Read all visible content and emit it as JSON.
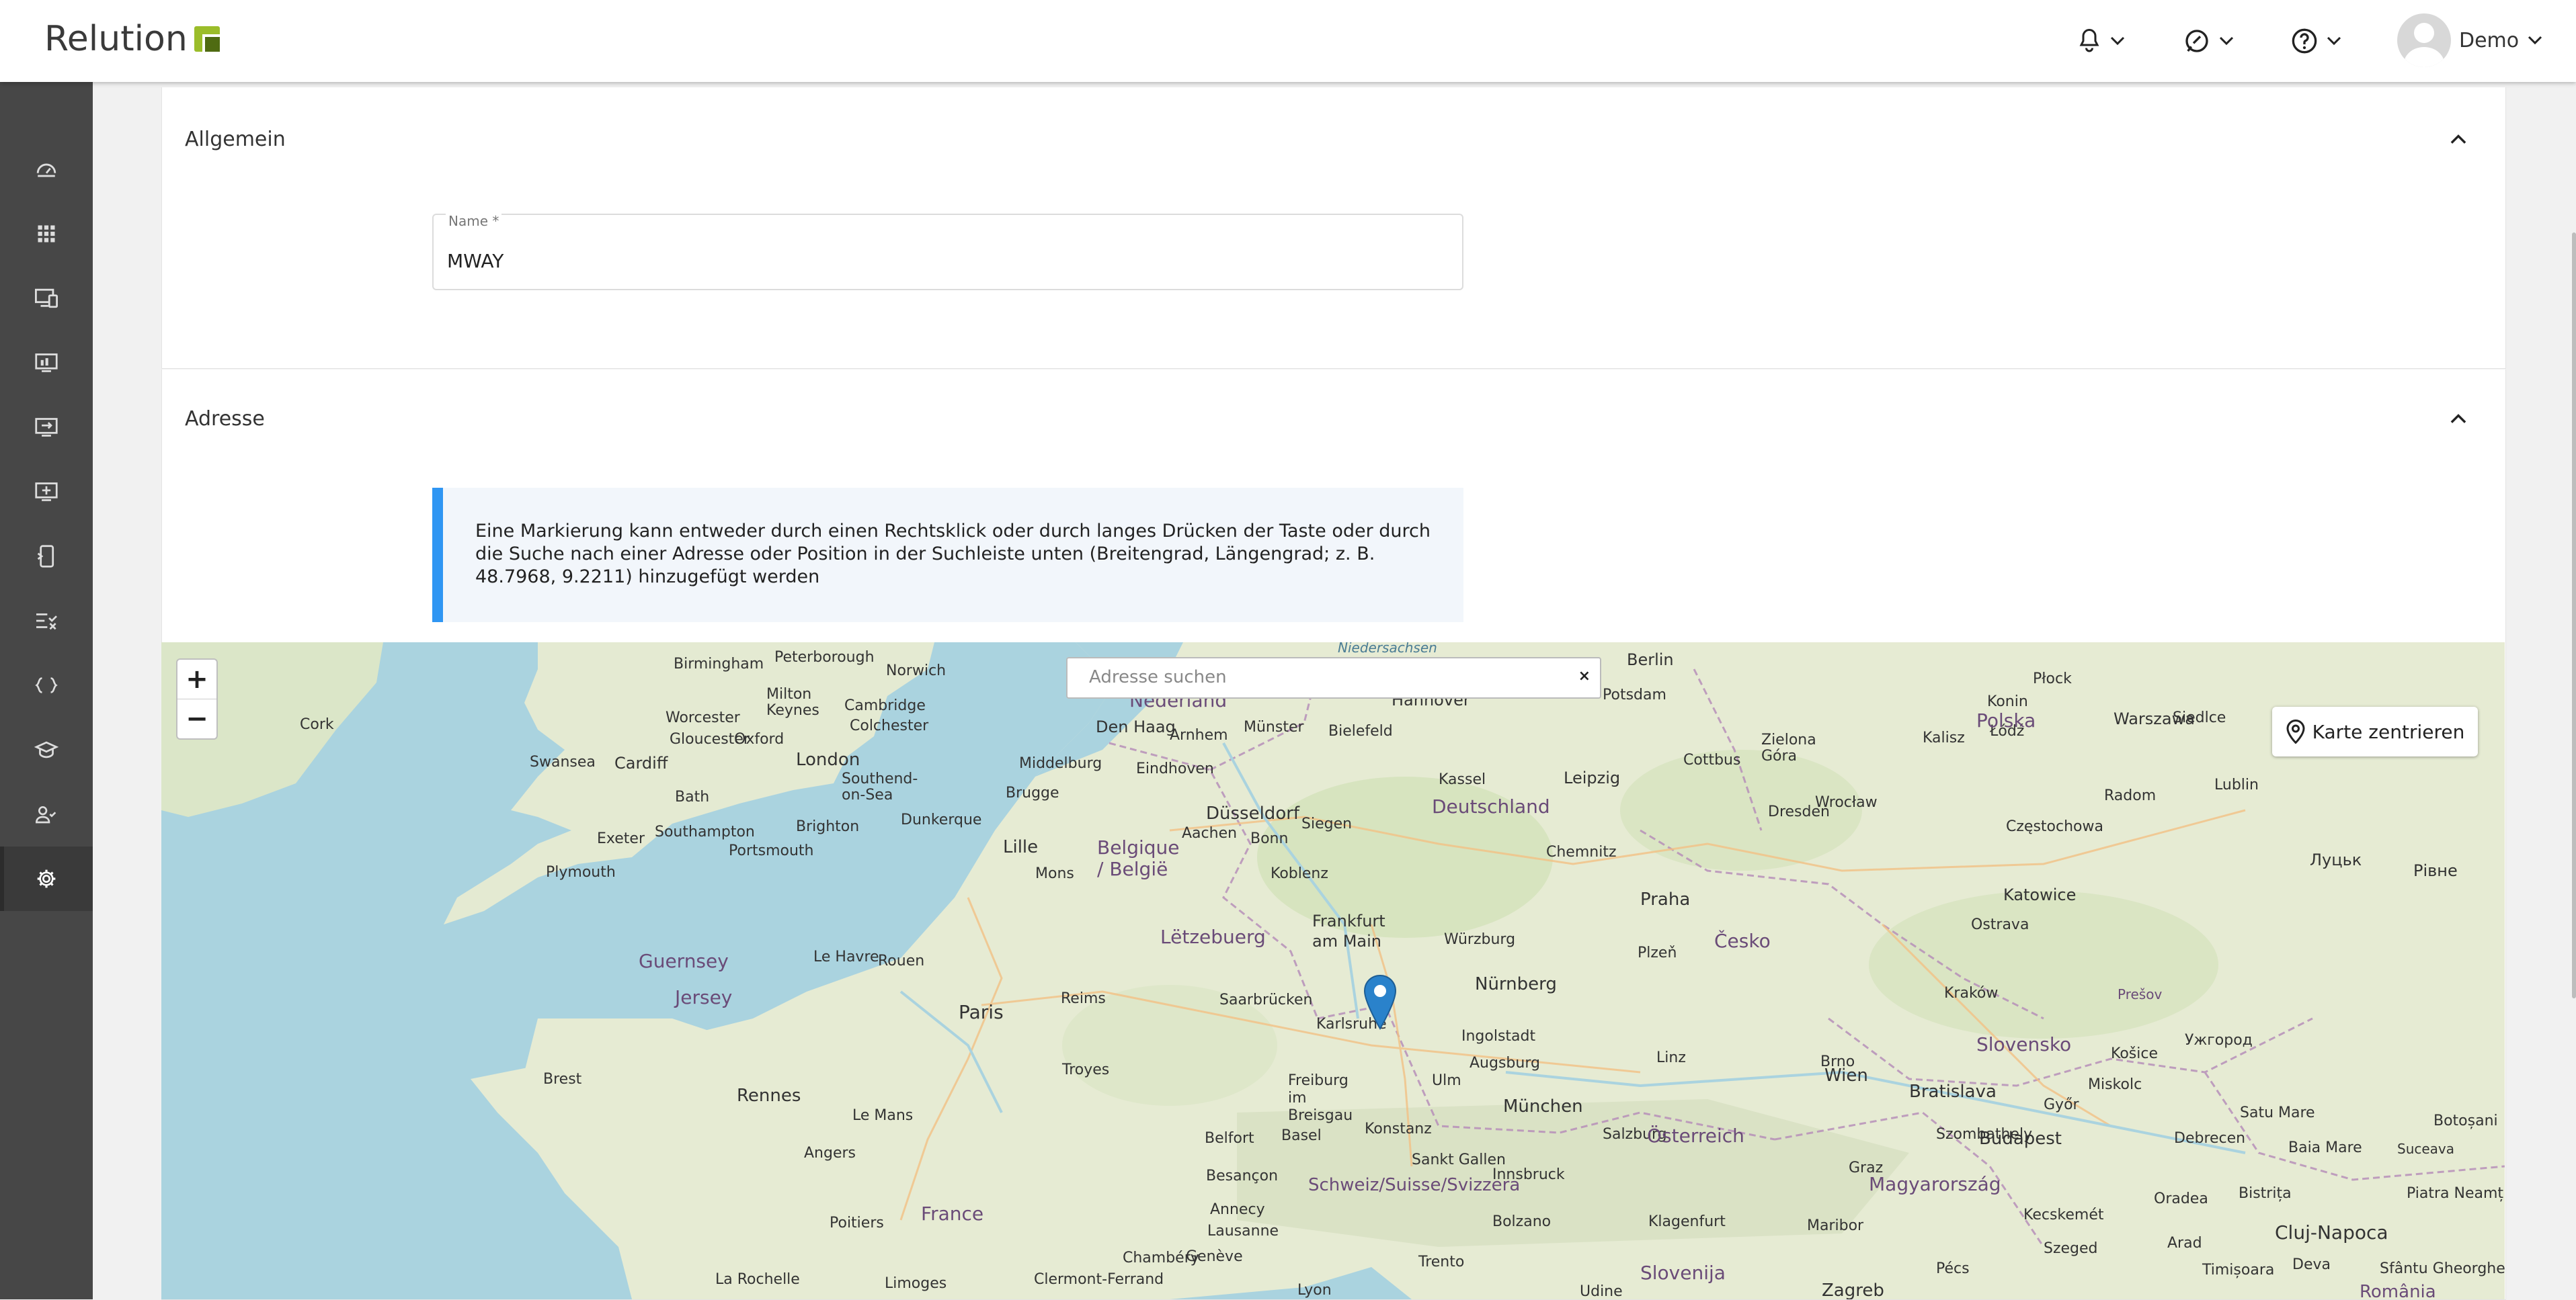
{
  "header": {
    "logo_text": "Relution",
    "user_name": "Demo",
    "icons": [
      "bell-icon",
      "chat-icon",
      "help-icon"
    ]
  },
  "sidebar": {
    "items": [
      {
        "icon": "dashboard-icon"
      },
      {
        "icon": "apps-icon"
      },
      {
        "icon": "devices-icon"
      },
      {
        "icon": "monitor-icon"
      },
      {
        "icon": "enrollment-icon"
      },
      {
        "icon": "add-device-icon"
      },
      {
        "icon": "mobile-icon"
      },
      {
        "icon": "compliance-icon"
      },
      {
        "icon": "code-icon"
      },
      {
        "icon": "education-icon"
      },
      {
        "icon": "users-icon"
      },
      {
        "icon": "settings-icon",
        "active": true
      }
    ]
  },
  "general": {
    "title": "Allgemein",
    "name_label": "Name *",
    "name_value": "MWAY"
  },
  "address": {
    "title": "Adresse",
    "info_text": "Eine Markierung kann entweder durch einen Rechtsklick oder durch langes Drücken der Taste oder durch die Suche nach einer Adresse oder Position in der Suchleiste unten (Breitengrad, Längengrad; z. B. 48.7968, 9.2211) hinzugefügt werden"
  },
  "map": {
    "zoom_in": "+",
    "zoom_out": "−",
    "search_placeholder": "Adresse suchen",
    "search_clear": "×",
    "center_button": "Karte zentrieren",
    "cities": [
      "Birmingham",
      "Peterborough",
      "Norwich",
      "Cork",
      "Worcester",
      "Milton Keynes",
      "Cambridge",
      "Colchester",
      "Gloucester",
      "Oxford",
      "Swansea",
      "Cardiff",
      "London",
      "Southend-on-Sea",
      "Bath",
      "Brighton",
      "Exeter",
      "Southampton",
      "Portsmouth",
      "Plymouth",
      "Den Haag",
      "Arnhem",
      "Münster",
      "Bielefeld",
      "Hannover",
      "Potsdam",
      "Berlin",
      "Middelburg",
      "Eindhoven",
      "Brugge",
      "Düsseldorf",
      "Kassel",
      "Leipzig",
      "Cottbus",
      "Zielona Góra",
      "Aachen",
      "Bonn",
      "Siegen",
      "Lille",
      "Mons",
      "Dunkerque",
      "Chemnitz",
      "Dresden",
      "Koblenz",
      "Frankfurt am Main",
      "Würzburg",
      "Praha",
      "Le Havre",
      "Rouen",
      "Reims",
      "Saarbrücken",
      "Nürnberg",
      "Paris",
      "Karlsruhe",
      "Ingolstadt",
      "Augsburg",
      "Ulm",
      "München",
      "Freiburg im Breisgau",
      "Konstanz",
      "Basel",
      "Belfort",
      "Troyes",
      "Rennes",
      "Brest",
      "Le Mans",
      "Angers",
      "Poitiers",
      "Besançon",
      "Lausanne",
      "Genève",
      "Sankt Gallen",
      "Salzburg",
      "Linz",
      "Wien",
      "Bratislava",
      "Budapest",
      "Plzeň",
      "Brno",
      "Ostrava",
      "Katowice",
      "Kraków",
      "Częstochowa",
      "Łódź",
      "Wrocław",
      "Warszawa",
      "Radom",
      "Lublin",
      "Kalisz",
      "Konin",
      "Płock",
      "Siedlce",
      "Луцьк",
      "Рівне",
      "Miskolc",
      "Košice",
      "Prešov",
      "Ужгород",
      "Debrecen",
      "Oradea",
      "Cluj-Napoca",
      "Bistrița",
      "Baia Mare",
      "Satu Mare",
      "Botoșani",
      "Suceava",
      "Piatra Neamț",
      "Kecskemét",
      "Szeged",
      "Timișoara",
      "Arad",
      "Deva",
      "Sfântu Gheorghe",
      "Pécs",
      "Maribor",
      "Graz",
      "Klagenfurt",
      "Innsbruck",
      "Trento",
      "Bolzano",
      "Udine",
      "Zagreb",
      "Szombathely",
      "Győr",
      "La Rochelle",
      "Limoges",
      "Clermont-Ferrand",
      "Lyon",
      "Annecy",
      "Chambéry"
    ],
    "countries": [
      "Nederland",
      "Belgique / België",
      "Deutschland",
      "Česko",
      "Polska",
      "Slovensko",
      "Österreich",
      "Magyarország",
      "Schweiz/Suisse/Svizzera",
      "France",
      "Slovenija",
      "România",
      "Lëtzebuerg",
      "Jersey",
      "Guernsey"
    ]
  }
}
